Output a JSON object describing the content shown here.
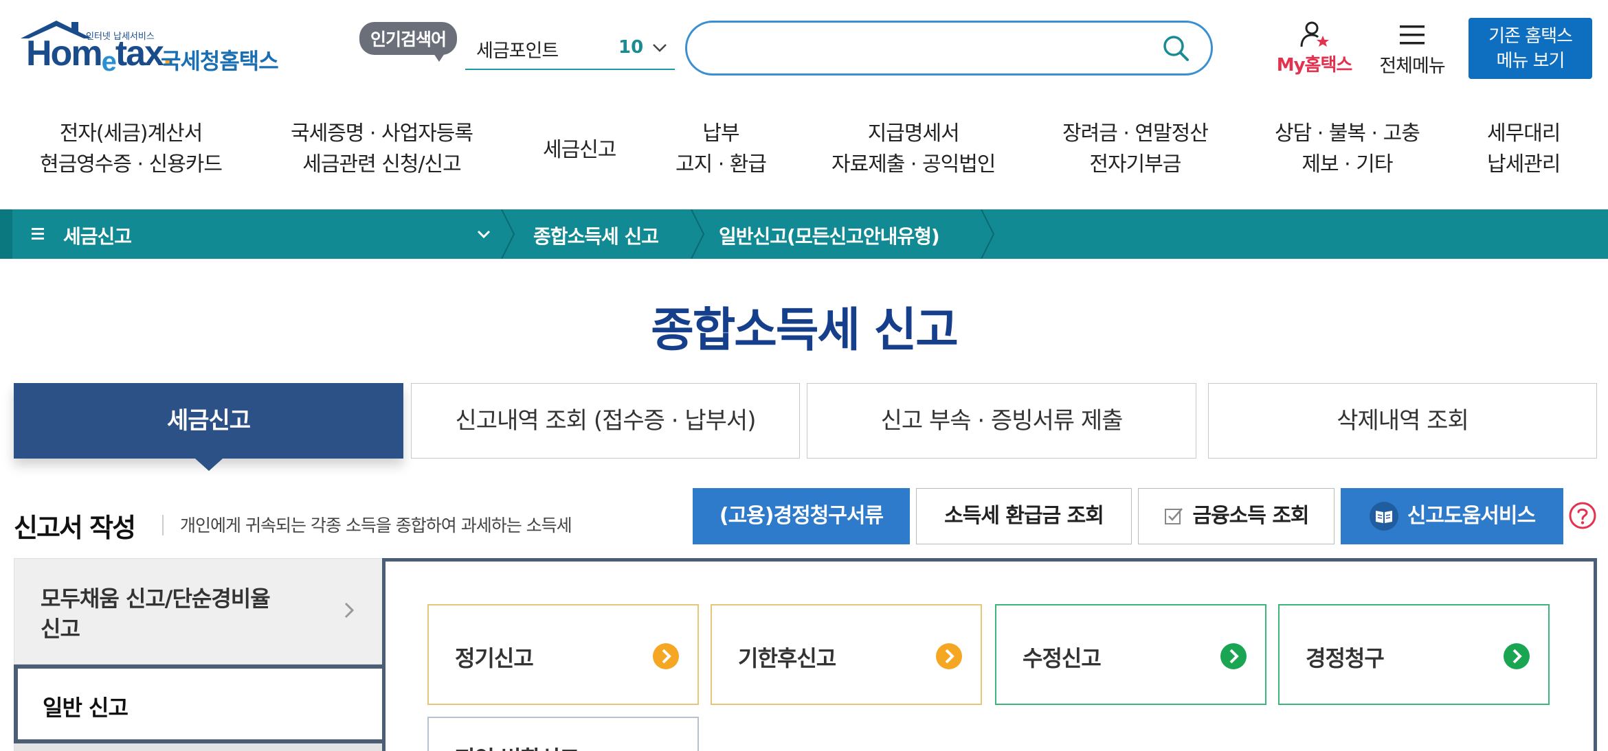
{
  "colors": {
    "brand_blue": "#1a4c8c",
    "teal_bar": "#118a93",
    "title_navy": "#153f8a",
    "active_tab": "#2b5186",
    "action_blue": "#2f7bcb",
    "my_red": "#e2324f",
    "card_yellow_arrow": "#f5a623",
    "card_green_arrow": "#1aa553"
  },
  "header": {
    "logo": {
      "small_text": "인터넷 납세서비스",
      "brand_pre": "Hom",
      "brand_e": "e",
      "brand_post": "tax",
      "brand_dot": ".",
      "korean_name": "국세청홈택스"
    },
    "popular": {
      "badge": "인기검색어",
      "keyword": "세금포인트",
      "rank": "10"
    },
    "search": {
      "placeholder": "",
      "value": ""
    },
    "my_hometax": "My홈택스",
    "all_menu": "전체메뉴",
    "old_menu": {
      "line1": "기존 홈택스",
      "line2": "메뉴 보기"
    }
  },
  "gnb": [
    {
      "line1": "전자(세금)계산서",
      "line2": "현금영수증 · 신용카드"
    },
    {
      "line1": "국세증명 · 사업자등록",
      "line2": "세금관련 신청/신고"
    },
    {
      "line1": "세금신고",
      "line2": ""
    },
    {
      "line1": "납부",
      "line2": "고지 · 환급"
    },
    {
      "line1": "지급명세서",
      "line2": "자료제출 · 공익법인"
    },
    {
      "line1": "장려금 · 연말정산",
      "line2": "전자기부금"
    },
    {
      "line1": "상담 · 불복 · 고충",
      "line2": "제보 · 기타"
    },
    {
      "line1": "세무대리",
      "line2": "납세관리"
    }
  ],
  "breadcrumb": {
    "menu": "세금신고",
    "items": [
      "종합소득세 신고",
      "일반신고(모든신고안내유형)"
    ]
  },
  "page_title": "종합소득세 신고",
  "tabs": [
    {
      "label": "세금신고",
      "active": true
    },
    {
      "label": "신고내역 조회 (접수증 · 납부서)",
      "active": false
    },
    {
      "label": "신고 부속 · 증빙서류 제출",
      "active": false
    },
    {
      "label": "삭제내역 조회",
      "active": false
    }
  ],
  "section": {
    "title": "신고서 작성",
    "description": "개인에게 귀속되는 각종 소득을 종합하여 과세하는 소득세"
  },
  "actions": {
    "employment_claim": "(고용)경정청구서류",
    "refund_lookup": "소득세 환급금 조회",
    "financial_income": "금융소득 조회",
    "help_service": "신고도움서비스"
  },
  "side_menu": {
    "item1_line1": "모두채움 신고/단순경비율",
    "item1_line2": "신고",
    "item2": "일반 신고"
  },
  "filing_types": {
    "regular": "정기신고",
    "late": "기한후신고",
    "amended": "수정신고",
    "claim": "경정청구",
    "partial": "피인 변환신고"
  }
}
